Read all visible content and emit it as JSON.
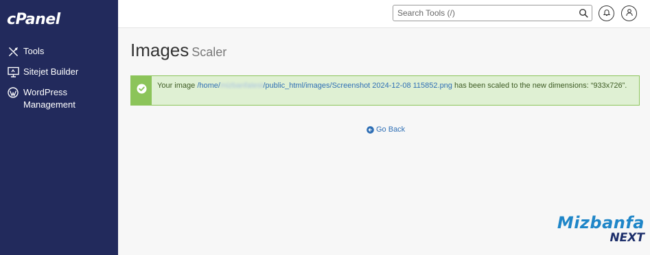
{
  "brand": {
    "logo_text": "cPanel"
  },
  "sidebar": {
    "items": [
      {
        "label": "Tools",
        "icon": "tools-icon"
      },
      {
        "label": "Sitejet Builder",
        "icon": "sitejet-icon"
      },
      {
        "label": "WordPress\nManagement",
        "icon": "wordpress-icon"
      }
    ]
  },
  "header": {
    "search_placeholder": "Search Tools (/)"
  },
  "page": {
    "title": "Images",
    "subtitle": "Scaler"
  },
  "alert": {
    "prefix": "Your image ",
    "path_start": "/home/",
    "path_hidden": "mizbanfatest",
    "path_end": "/public_html/images/Screenshot 2024-12-08 115852.png",
    "suffix": " has been scaled to the new dimensions: “933x726”."
  },
  "actions": {
    "go_back": "Go Back"
  },
  "watermark": {
    "line1": "Mizbanfa",
    "line2": "NEXT"
  },
  "colors": {
    "sidebar": "#222a5c",
    "success_border": "#8cc45a",
    "success_bg": "#dff0d3",
    "link": "#2f6fb5"
  }
}
